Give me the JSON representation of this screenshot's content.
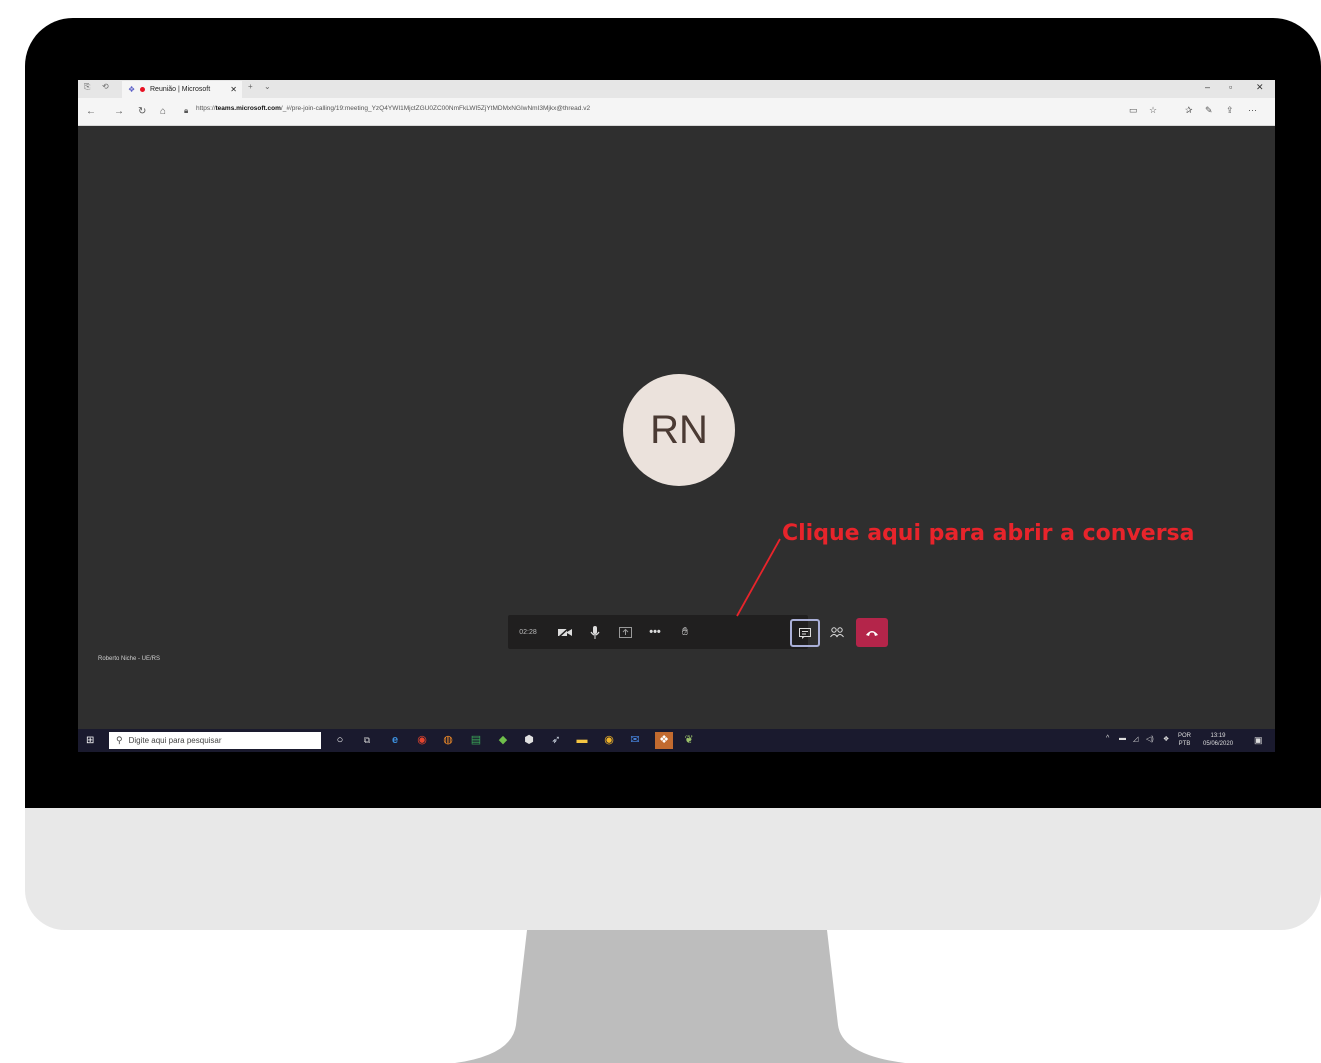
{
  "browser": {
    "tab_title": "Reunião | Microsoft",
    "url_prefix": "https://",
    "url_domain": "teams.microsoft.com",
    "url_path": "/_#/pre-join-calling/19:meeting_YzQ4YWI1MjctZGU0ZC00NmFkLWI5ZjYtMDMxNGIwNmI3Mjkx@thread.v2"
  },
  "meeting": {
    "avatar_initials": "RN",
    "participant_name": "Roberto Niche - UE/RS",
    "timer": "02:28"
  },
  "annotation": {
    "text": "Clique aqui para abrir a conversa",
    "color": "#e8242b"
  },
  "taskbar": {
    "search_placeholder": "Digite aqui para pesquisar",
    "lang_top": "POR",
    "lang_bottom": "PTB",
    "time": "13:19",
    "date": "05/06/2020"
  },
  "colors": {
    "meeting_bg": "#2f2f2f",
    "hangup": "#b4254a",
    "avatar_bg": "#ebe2dc"
  }
}
